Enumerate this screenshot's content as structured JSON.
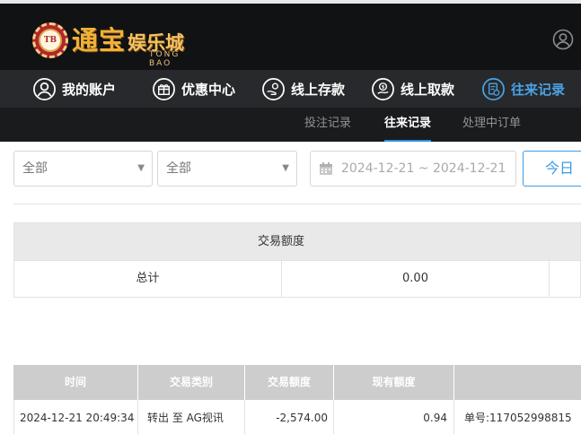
{
  "brand": {
    "logo_chip": "TB",
    "logo_big": "通宝",
    "logo_small": "娱乐城",
    "logo_sub": "TONG BAO"
  },
  "main_nav": [
    {
      "label": "我的账户",
      "icon": "user-circle-icon"
    },
    {
      "label": "优惠中心",
      "icon": "gift-icon"
    },
    {
      "label": "线上存款",
      "icon": "deposit-icon"
    },
    {
      "label": "线上取款",
      "icon": "withdraw-icon"
    },
    {
      "label": "往来记录",
      "icon": "records-icon"
    }
  ],
  "sub_nav": [
    {
      "label": "投注记录"
    },
    {
      "label": "往来记录"
    },
    {
      "label": "处理中订单"
    }
  ],
  "filters": {
    "select1_value": "全部",
    "select2_value": "全部",
    "date_range": "2024-12-21 ~ 2024-12-21",
    "today_button": "今日"
  },
  "summary": {
    "header": "交易额度",
    "row_label": "总计",
    "row_value": "0.00"
  },
  "detail_table": {
    "columns": [
      "时间",
      "交易类别",
      "交易额度",
      "现有额度",
      ""
    ],
    "rows": [
      [
        "2024-12-21 20:49:34",
        "转出 至 AG视讯",
        "-2,574.00",
        "0.94",
        "单号:117052998815"
      ]
    ]
  },
  "colors": {
    "header_bg": "#111214",
    "nav_bg": "#27292c",
    "accent_blue": "#4ba3e6",
    "logo_gold": "#f0b13a"
  }
}
